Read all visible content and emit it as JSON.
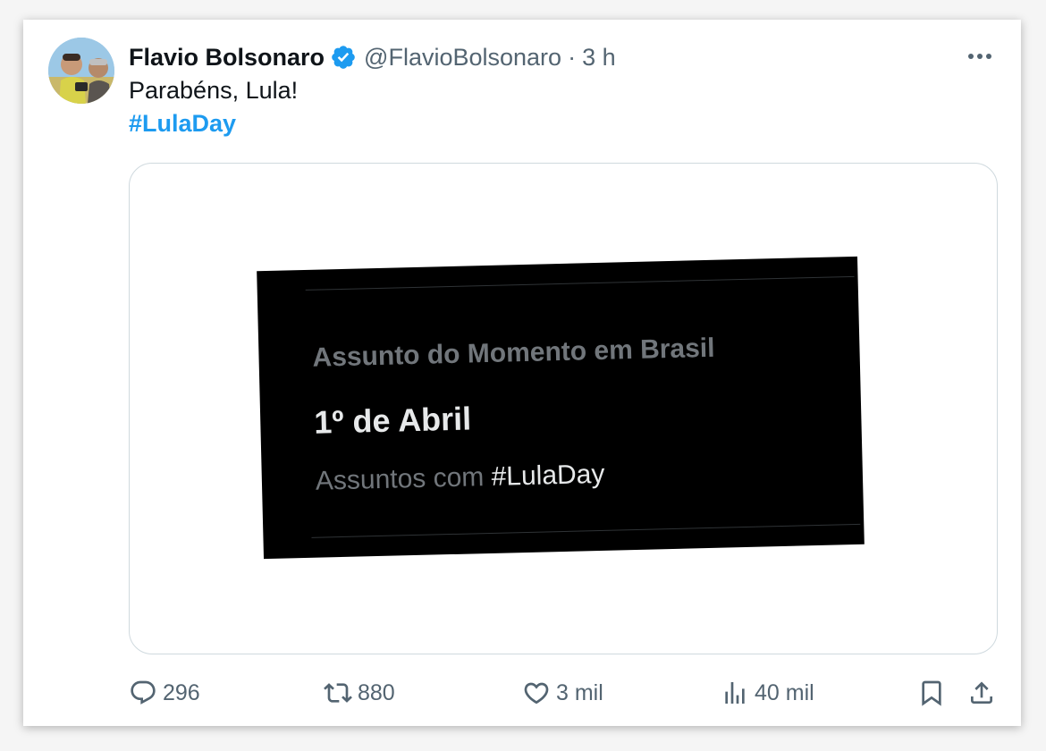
{
  "post": {
    "author_name": "Flavio Bolsonaro",
    "handle": "@FlavioBolsonaro",
    "separator": "·",
    "time": "3 h",
    "text": "Parabéns, Lula!",
    "hashtag": "#LulaDay",
    "verified": true,
    "accent_color": "#1d9bf0"
  },
  "media": {
    "context": "Assunto do Momento em Brasil",
    "title": "1º de Abril",
    "meta_prefix": "Assuntos com",
    "meta_tag": "#LulaDay"
  },
  "actions": {
    "replies": "296",
    "reposts": "880",
    "likes": "3 mil",
    "views": "40 mil"
  },
  "icons": [
    "avatar",
    "verified-badge-icon",
    "more-icon",
    "reply-icon",
    "repost-icon",
    "like-icon",
    "views-icon",
    "bookmark-icon",
    "share-icon"
  ]
}
